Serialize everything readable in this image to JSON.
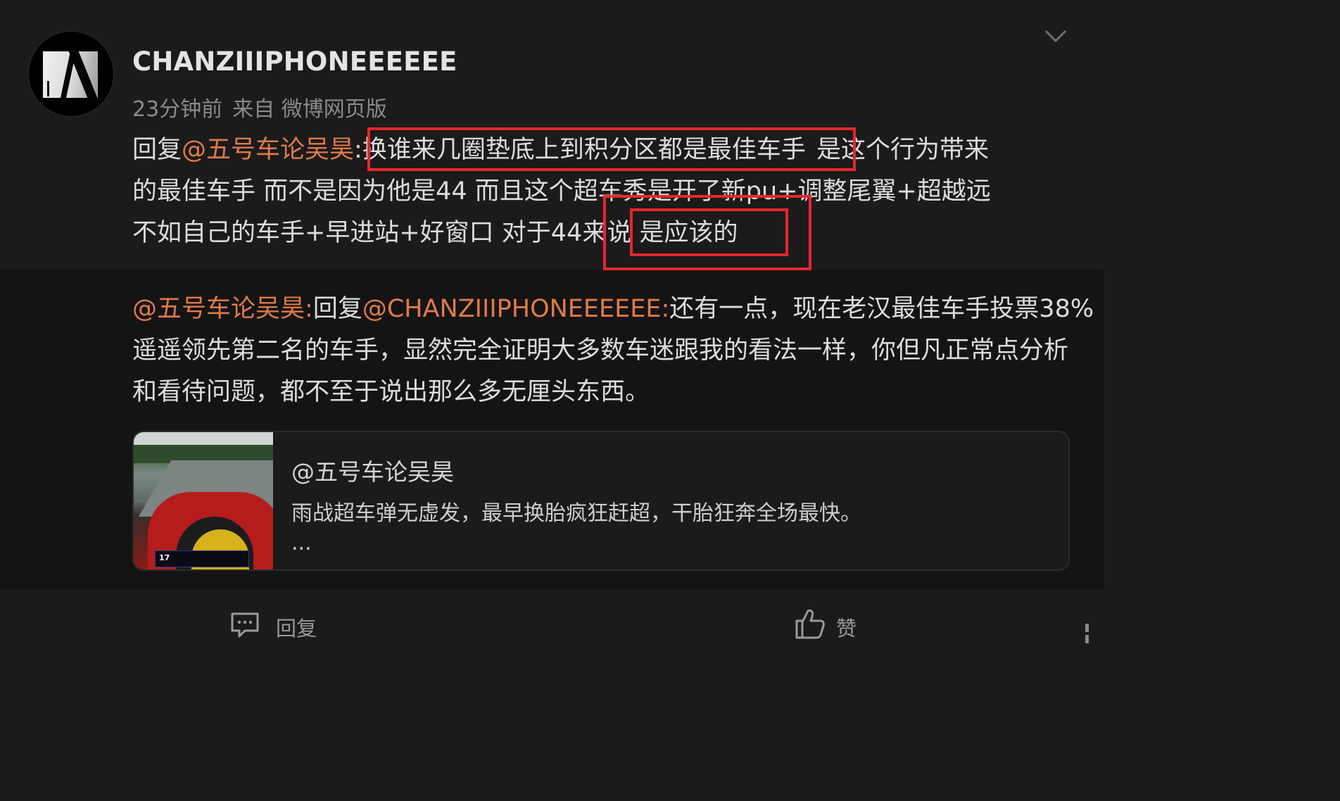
{
  "post": {
    "username": "CHANZIIIPHONEEEEEE",
    "time": "23分钟前",
    "source": "来自 微博网页版",
    "lines": {
      "l1_prefix": "回复",
      "l1_mention": "@五号车论吴昊",
      "l1_colon": ":",
      "l1_boxed": "换谁来几圈垫底上到积分区都是最佳车手",
      "l1_rest": "是这个行为带来",
      "l2": "的最佳车手 而不是因为他是44 而且这个超车秀是开了新pu+调整尾翼+超越远",
      "l3_main": "不如自己的车手+早进站+好窗口 对于44来说",
      "l3_boxed": "是应该的"
    }
  },
  "retweet": {
    "mention_author": "@五号车论吴昊",
    "colon1": ":",
    "reply_word": "回复",
    "mention_target": "@CHANZIIIPHONEEEEEE",
    "colon2": ":",
    "l1_text": "还有一点，现在老汉最佳车手投票38%",
    "l2": "遥遥领先第二名的车手，显然完全证明大多数车迷跟我的看法一样，你但凡正常点分析",
    "l3": "和看待问题，都不至于说出那么多无厘头东西。"
  },
  "card": {
    "title": "@五号车论吴昊",
    "desc": "雨战超车弹无虚发，最早换胎疯狂赶超，干胎狂奔全场最快。",
    "more": "...",
    "thumb_number": "17"
  },
  "footer": {
    "reply_label": "回复",
    "like_label": "赞"
  },
  "icons": {
    "collapse": "chevron-down-icon",
    "reply": "comment-icon",
    "like": "thumbs-up-icon"
  },
  "colors": {
    "background": "#1b1b1b",
    "retweet_background": "#141414",
    "mention": "#e07a4a",
    "annotation": "#e8262c"
  }
}
